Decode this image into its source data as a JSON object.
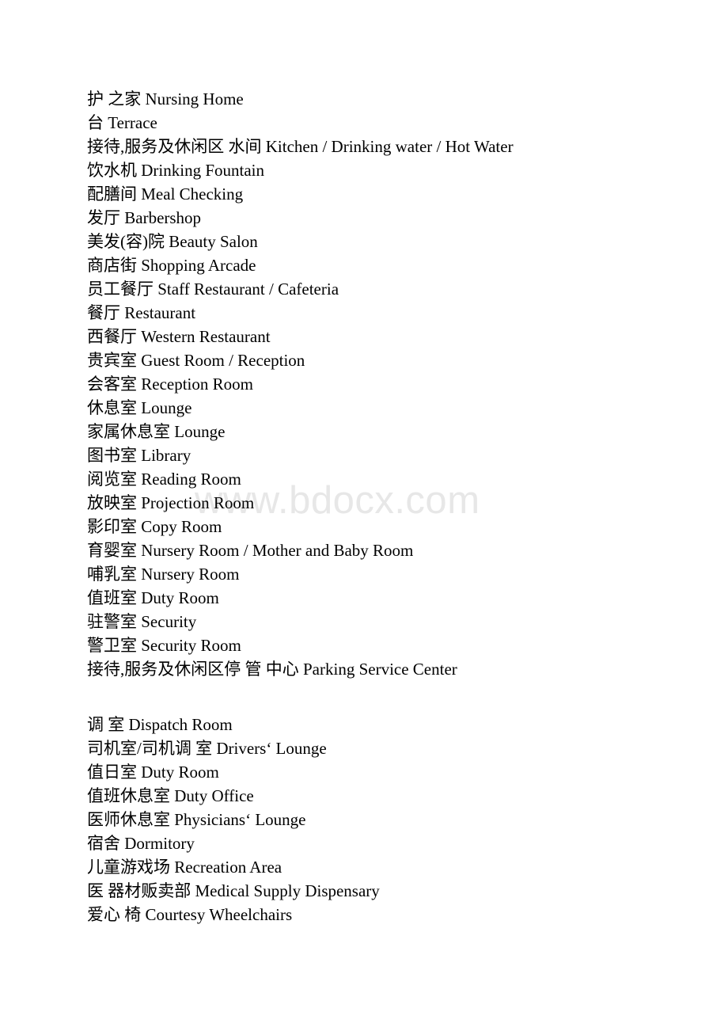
{
  "document": {
    "background_color": "#ffffff",
    "text_color": "#000000",
    "watermark": {
      "text": "www.bdocx.com",
      "color": "#e7e7e7"
    },
    "blocks": [
      {
        "id": "block-1",
        "lines": [
          "护 之家 Nursing Home",
          "台 Terrace",
          "接待,服务及休闲区 水间 Kitchen / Drinking water / Hot Water",
          "饮水机 Drinking Fountain",
          "配膳间 Meal Checking",
          "发厅 Barbershop",
          "美发(容)院 Beauty Salon",
          "商店街 Shopping Arcade",
          "员工餐厅 Staff Restaurant / Cafeteria",
          "餐厅 Restaurant",
          "西餐厅 Western Restaurant",
          "贵宾室 Guest Room / Reception",
          "会客室 Reception Room",
          "休息室 Lounge",
          "家属休息室 Lounge",
          "图书室 Library",
          "阅览室 Reading Room",
          "放映室 Projection Room",
          "影印室 Copy Room",
          "育婴室 Nursery Room / Mother and Baby Room",
          "哺乳室 Nursery Room",
          "值班室 Duty Room",
          "驻警室 Security",
          "警卫室 Security Room",
          "接待,服务及休闲区停 管 中心 Parking Service Center"
        ]
      },
      {
        "id": "block-2",
        "lines": [
          "调 室 Dispatch Room",
          "司机室/司机调 室 Drivers‘ Lounge",
          "值日室 Duty Room",
          "值班休息室 Duty Office",
          "医师休息室 Physicians‘ Lounge",
          "宿舍 Dormitory",
          "儿童游戏场 Recreation Area",
          "医 器材贩卖部 Medical Supply Dispensary",
          "爱心 椅 Courtesy Wheelchairs"
        ]
      }
    ]
  }
}
